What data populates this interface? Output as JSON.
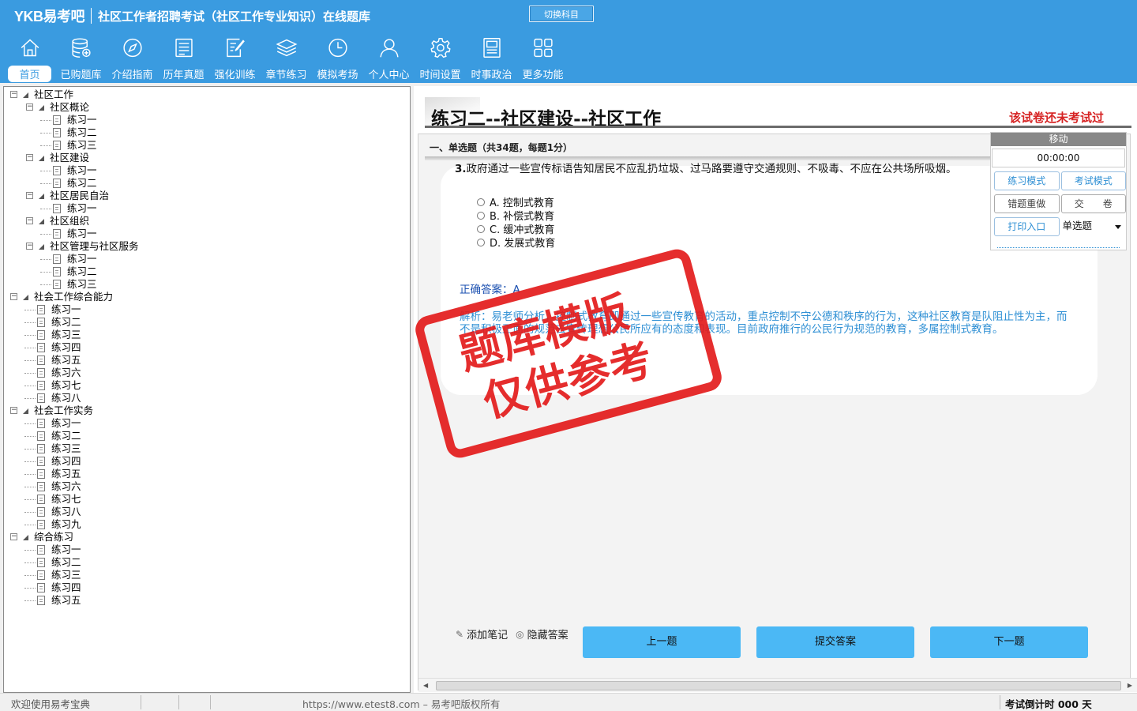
{
  "header": {
    "logo": "YKB易考吧",
    "title": "社区工作者招聘考试（社区工作专业知识）在线题库",
    "switch_label": "切换科目"
  },
  "nav": [
    {
      "label": "首页",
      "icon": "home-icon"
    },
    {
      "label": "已购题库",
      "icon": "database-icon"
    },
    {
      "label": "介绍指南",
      "icon": "compass-icon"
    },
    {
      "label": "历年真题",
      "icon": "list-icon"
    },
    {
      "label": "强化训练",
      "icon": "edit-icon"
    },
    {
      "label": "章节练习",
      "icon": "layers-icon"
    },
    {
      "label": "模拟考场",
      "icon": "clock-icon"
    },
    {
      "label": "个人中心",
      "icon": "user-icon"
    },
    {
      "label": "时间设置",
      "icon": "gear-icon"
    },
    {
      "label": "时事政治",
      "icon": "newspaper-icon"
    },
    {
      "label": "更多功能",
      "icon": "grid-icon"
    }
  ],
  "tree": [
    {
      "label": "社区工作",
      "level": 0
    },
    {
      "label": "社区概论",
      "level": 1
    },
    {
      "label": "练习一",
      "level": 2
    },
    {
      "label": "练习二",
      "level": 2
    },
    {
      "label": "练习三",
      "level": 2
    },
    {
      "label": "社区建设",
      "level": 1
    },
    {
      "label": "练习一",
      "level": 2
    },
    {
      "label": "练习二",
      "level": 2
    },
    {
      "label": "社区居民自治",
      "level": 1
    },
    {
      "label": "练习一",
      "level": 2
    },
    {
      "label": "社区组织",
      "level": 1
    },
    {
      "label": "练习一",
      "level": 2
    },
    {
      "label": "社区管理与社区服务",
      "level": 1
    },
    {
      "label": "练习一",
      "level": 2
    },
    {
      "label": "练习二",
      "level": 2
    },
    {
      "label": "练习三",
      "level": 2
    },
    {
      "label": "社会工作综合能力",
      "level": 0
    },
    {
      "label": "练习一",
      "level": 1
    },
    {
      "label": "练习二",
      "level": 1
    },
    {
      "label": "练习三",
      "level": 1
    },
    {
      "label": "练习四",
      "level": 1
    },
    {
      "label": "练习五",
      "level": 1
    },
    {
      "label": "练习六",
      "level": 1
    },
    {
      "label": "练习七",
      "level": 1
    },
    {
      "label": "练习八",
      "level": 1
    },
    {
      "label": "社会工作实务",
      "level": 0
    },
    {
      "label": "练习一",
      "level": 1
    },
    {
      "label": "练习二",
      "level": 1
    },
    {
      "label": "练习三",
      "level": 1
    },
    {
      "label": "练习四",
      "level": 1
    },
    {
      "label": "练习五",
      "level": 1
    },
    {
      "label": "练习六",
      "level": 1
    },
    {
      "label": "练习七",
      "level": 1
    },
    {
      "label": "练习八",
      "level": 1
    },
    {
      "label": "练习九",
      "level": 1
    },
    {
      "label": "综合练习",
      "level": 0
    },
    {
      "label": "练习一",
      "level": 1
    },
    {
      "label": "练习二",
      "level": 1
    },
    {
      "label": "练习三",
      "level": 1
    },
    {
      "label": "练习四",
      "level": 1
    },
    {
      "label": "练习五",
      "level": 1
    }
  ],
  "paper": {
    "title": "练习二--社区建设--社区工作",
    "status": "该试卷还未考试过",
    "section": "一、单选题（共34题，每题1分）"
  },
  "question": {
    "number": "3.",
    "text": "政府通过一些宣传标语告知居民不应乱扔垃圾、过马路要遵守交通规则、不吸毒、不应在公共场所吸烟。",
    "options": [
      "A. 控制式教育",
      "B. 补偿式教育",
      "C. 缓冲式教育",
      "D. 发展式教育"
    ],
    "answer_label": "正确答案：",
    "answer": "A",
    "analysis": "解析：易老师分析，控制式教育即通过一些宣传教育的活动，重点控制不守公德和秩序的行为，这种社区教育是队阻止性为主，而不是积极正面的规范去宣传理想公民所应有的态度和表现。目前政府推行的公民行为规范的教育，多属控制式教育。"
  },
  "stamp": {
    "line1": "题库模版",
    "line2": "仅供参考"
  },
  "control": {
    "head": "移动",
    "timer": "00:00:00",
    "practice_mode": "练习模式",
    "exam_mode": "考试模式",
    "redo_wrong": "错题重做",
    "submit_paper": "交　　卷",
    "print_entry": "打印入口",
    "type_select": "单选题"
  },
  "actions": {
    "add_note": "添加笔记",
    "hide_answer": "隐藏答案",
    "prev": "上一题",
    "submit": "提交答案",
    "next": "下一题"
  },
  "status": {
    "welcome": "欢迎使用易考宝典",
    "copyright": "https://www.etest8.com – 易考吧版权所有",
    "countdown": "考试倒计时 000 天"
  }
}
